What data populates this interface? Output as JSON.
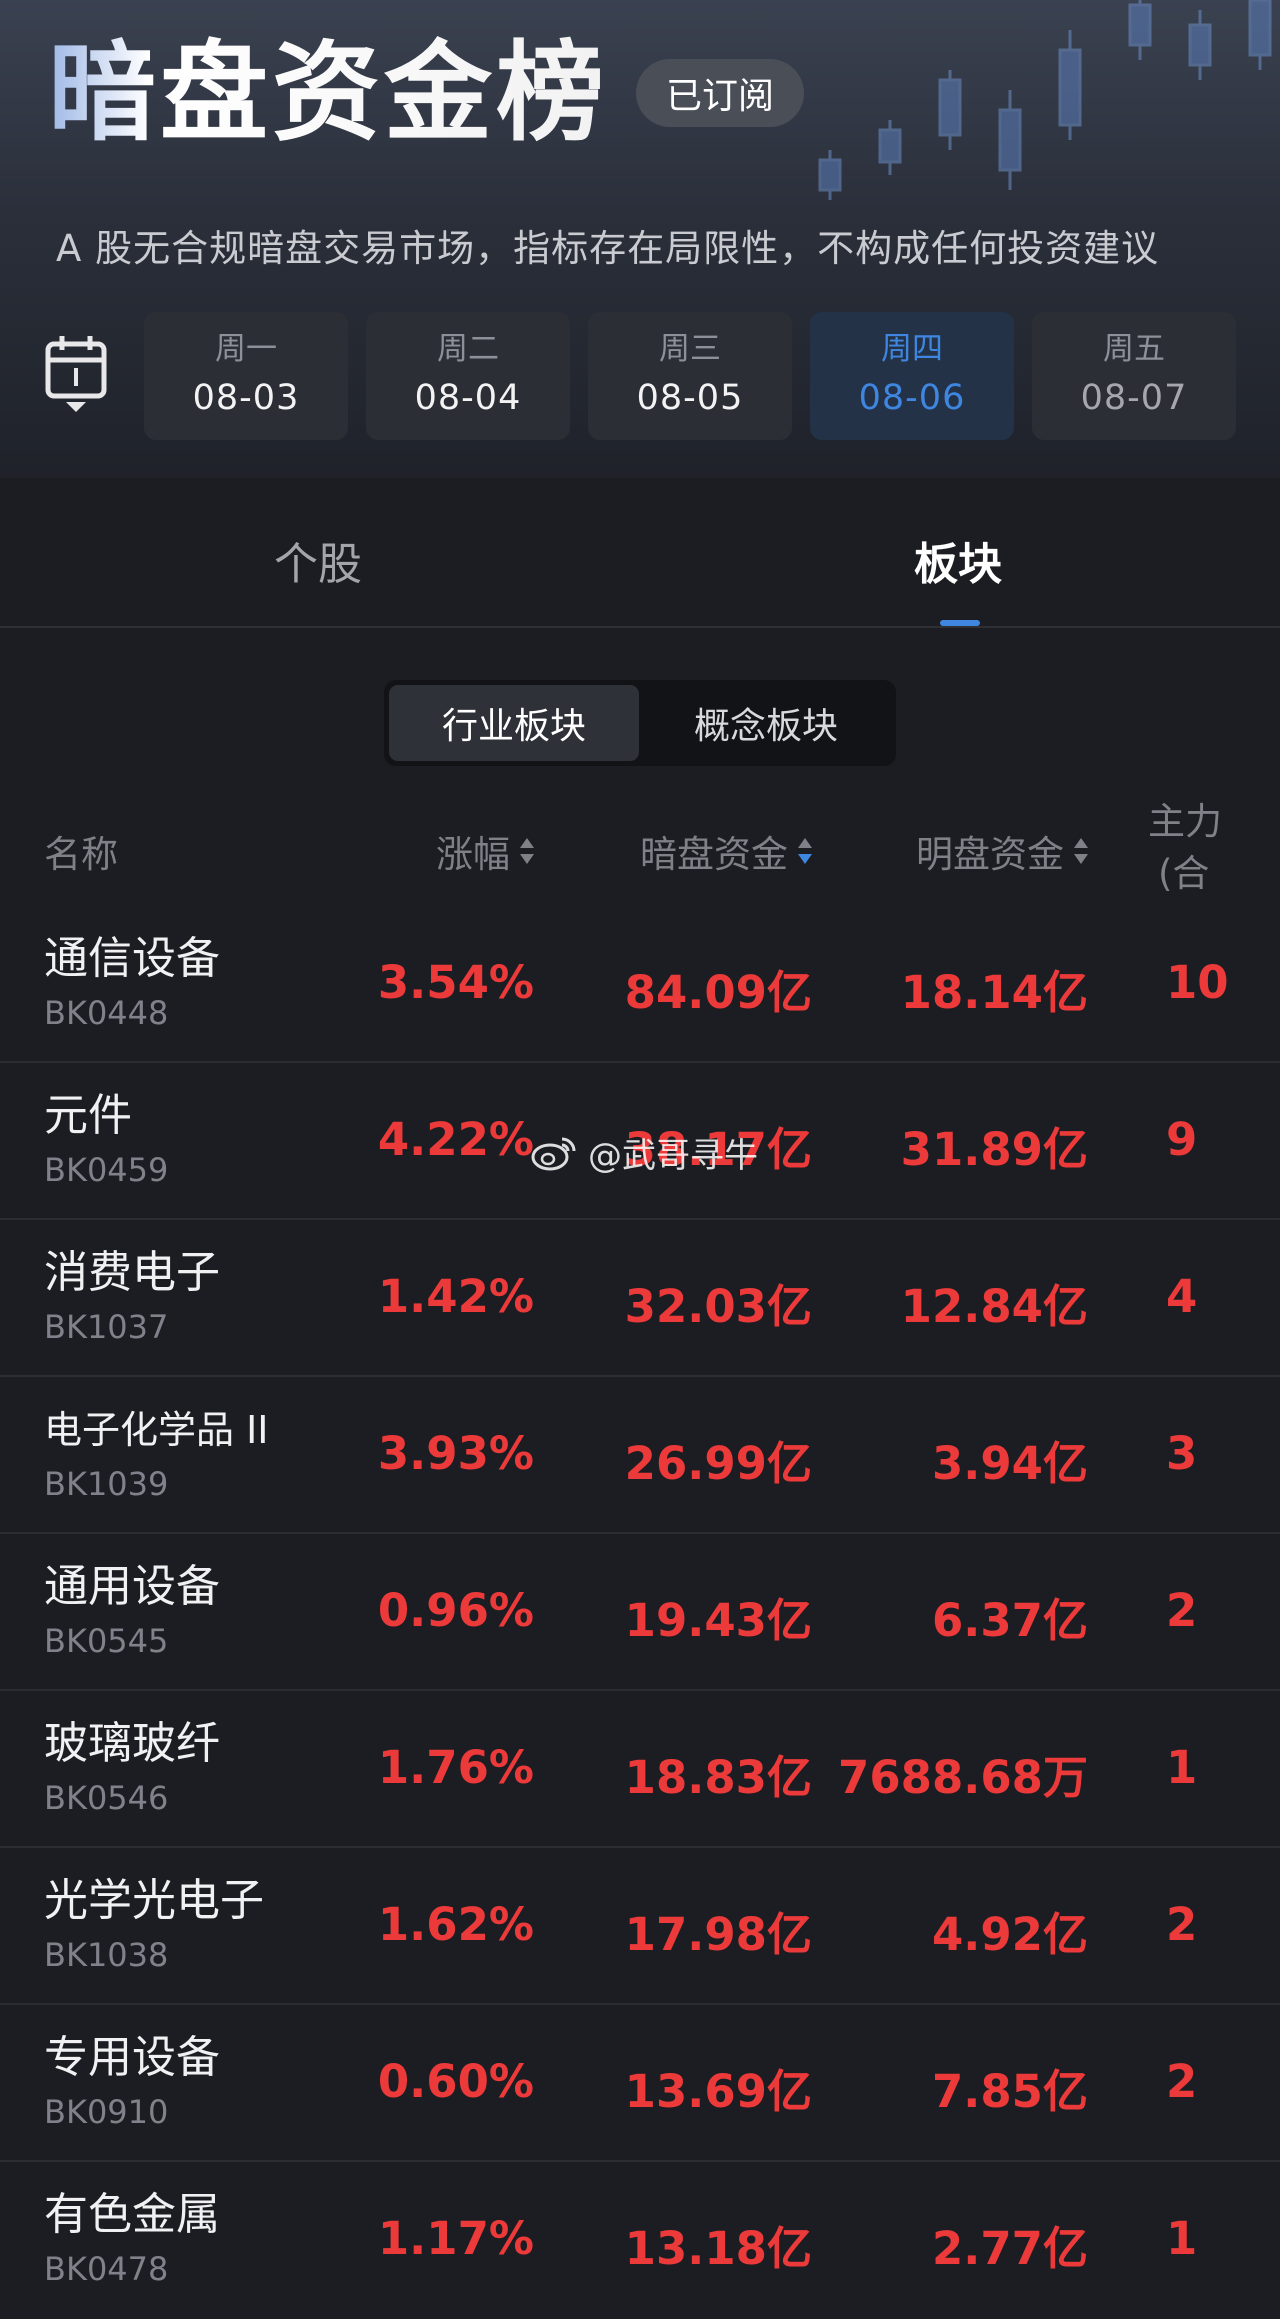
{
  "header": {
    "title": "暗盘资金榜",
    "subscribe_badge": "已订阅",
    "disclaimer": "A 股无合规暗盘交易市场，指标存在局限性，不构成任何投资建议"
  },
  "days": [
    {
      "weekday": "周一",
      "date": "08-03"
    },
    {
      "weekday": "周二",
      "date": "08-04"
    },
    {
      "weekday": "周三",
      "date": "08-05"
    },
    {
      "weekday": "周四",
      "date": "08-06"
    },
    {
      "weekday": "周五",
      "date": "08-07"
    }
  ],
  "tabs": {
    "stocks": "个股",
    "sectors": "板块"
  },
  "segment": {
    "industry": "行业板块",
    "concept": "概念板块"
  },
  "columns": {
    "name": "名称",
    "change": "涨幅",
    "dark_fund": "暗盘资金",
    "lit_fund": "明盘资金",
    "main_line1": "主力",
    "main_line2": "(合"
  },
  "rows": [
    {
      "name": "通信设备",
      "code": "BK0448",
      "change": "3.54%",
      "dark": "84.09亿",
      "lit": "18.14亿",
      "main": "10"
    },
    {
      "name": "元件",
      "code": "BK0459",
      "change": "4.22%",
      "dark": "38.17亿",
      "lit": "31.89亿",
      "main": "9"
    },
    {
      "name": "消费电子",
      "code": "BK1037",
      "change": "1.42%",
      "dark": "32.03亿",
      "lit": "12.84亿",
      "main": "4"
    },
    {
      "name": "电子化学品 II",
      "code": "BK1039",
      "change": "3.93%",
      "dark": "26.99亿",
      "lit": "3.94亿",
      "main": "3"
    },
    {
      "name": "通用设备",
      "code": "BK0545",
      "change": "0.96%",
      "dark": "19.43亿",
      "lit": "6.37亿",
      "main": "2"
    },
    {
      "name": "玻璃玻纤",
      "code": "BK0546",
      "change": "1.76%",
      "dark": "18.83亿",
      "lit": "7688.68万",
      "main": "1"
    },
    {
      "name": "光学光电子",
      "code": "BK1038",
      "change": "1.62%",
      "dark": "17.98亿",
      "lit": "4.92亿",
      "main": "2"
    },
    {
      "name": "专用设备",
      "code": "BK0910",
      "change": "0.60%",
      "dark": "13.69亿",
      "lit": "7.85亿",
      "main": "2"
    },
    {
      "name": "有色金属",
      "code": "BK0478",
      "change": "1.17%",
      "dark": "13.18亿",
      "lit": "2.77亿",
      "main": "1"
    }
  ],
  "watermark": "@武哥寻牛",
  "colors": {
    "accent": "#3f86e0",
    "up": "#ec3a3a"
  }
}
